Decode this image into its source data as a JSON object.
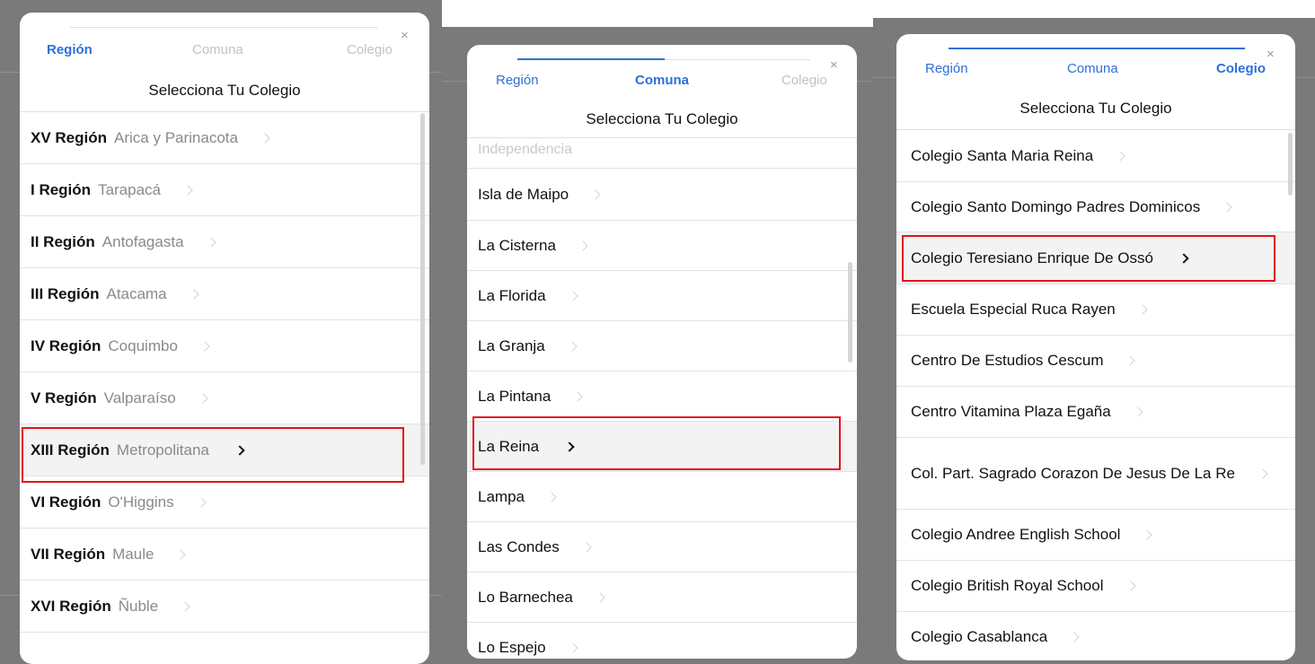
{
  "colors": {
    "accent": "#2d6fd8",
    "highlight": "#e3121b",
    "backdrop": "#7a7a7a"
  },
  "icons": {
    "close": "close-icon",
    "chevron": "chevron-right-icon"
  },
  "panels": [
    {
      "steps": {
        "region": "Región",
        "comuna": "Comuna",
        "colegio": "Colegio"
      },
      "active_step": "region",
      "title": "Selecciona Tu Colegio",
      "close_glyph": "×",
      "rows": [
        {
          "label": "XV Región",
          "sub": "Arica y Parinacota"
        },
        {
          "label": "I Región",
          "sub": "Tarapacá"
        },
        {
          "label": "II Región",
          "sub": "Antofagasta"
        },
        {
          "label": "III Región",
          "sub": "Atacama"
        },
        {
          "label": "IV Región",
          "sub": "Coquimbo"
        },
        {
          "label": "V Región",
          "sub": "Valparaíso"
        },
        {
          "label": "XIII Región",
          "sub": "Metropolitana",
          "selected": true
        },
        {
          "label": "VI Región",
          "sub": "O'Higgins"
        },
        {
          "label": "VII Región",
          "sub": "Maule"
        },
        {
          "label": "XVI Región",
          "sub": "Ñuble"
        }
      ]
    },
    {
      "steps": {
        "region": "Región",
        "comuna": "Comuna",
        "colegio": "Colegio"
      },
      "active_step": "comuna",
      "title": "Selecciona Tu Colegio",
      "close_glyph": "×",
      "partial_row": "Independencia",
      "rows": [
        {
          "label": "Isla de Maipo"
        },
        {
          "label": "La Cisterna"
        },
        {
          "label": "La Florida"
        },
        {
          "label": "La Granja"
        },
        {
          "label": "La Pintana"
        },
        {
          "label": "La Reina",
          "selected": true
        },
        {
          "label": "Lampa"
        },
        {
          "label": "Las Condes"
        },
        {
          "label": "Lo Barnechea"
        },
        {
          "label": "Lo Espejo"
        }
      ]
    },
    {
      "steps": {
        "region": "Región",
        "comuna": "Comuna",
        "colegio": "Colegio"
      },
      "active_step": "colegio",
      "title": "Selecciona Tu Colegio",
      "close_glyph": "×",
      "rows": [
        {
          "label": "Colegio Santa Maria Reina"
        },
        {
          "label": "Colegio Santo Domingo Padres Dominicos"
        },
        {
          "label": "Colegio Teresiano Enrique De Ossó",
          "selected": true
        },
        {
          "label": "Escuela Especial Ruca Rayen"
        },
        {
          "label": "Centro De Estudios Cescum"
        },
        {
          "label": "Centro Vitamina Plaza Egaña"
        },
        {
          "label": "Col. Part. Sagrado Corazon De Jesus De La Re"
        },
        {
          "label": "Colegio Andree English School"
        },
        {
          "label": "Colegio British Royal School"
        },
        {
          "label": "Colegio Casablanca"
        }
      ]
    }
  ]
}
